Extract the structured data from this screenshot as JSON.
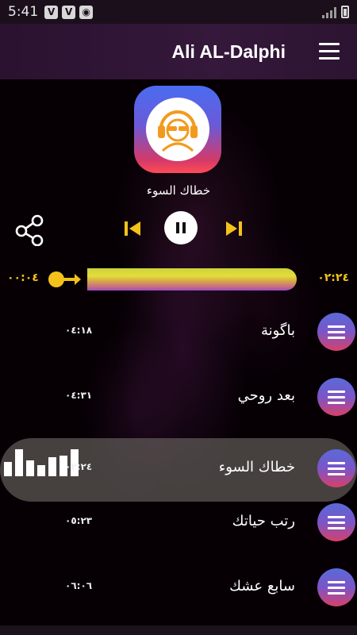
{
  "status_bar": {
    "time": "5:41",
    "icons": [
      {
        "name": "v-icon",
        "glyph": "V"
      },
      {
        "name": "v-icon-2",
        "glyph": "V"
      },
      {
        "name": "target-icon",
        "glyph": "◉"
      }
    ]
  },
  "app_bar": {
    "title": "Ali AL-Dalphi",
    "menu_icon": "hamburger-menu-icon"
  },
  "player": {
    "now_playing": "خطاك السوء",
    "elapsed": "٠٠:٠٤",
    "total": "٠٢:٢٤",
    "progress_fraction": 0.03
  },
  "tracks": [
    {
      "title": "باگونة",
      "duration": "٠٤:١٨",
      "active": false
    },
    {
      "title": "بعد روحي",
      "duration": "٠٤:٣١",
      "active": false
    },
    {
      "title": "خطاك السوء",
      "duration": "٠٢:٢٤",
      "active": true
    },
    {
      "title": "رتب حياتك",
      "duration": "٠٥:٢٣",
      "active": false
    },
    {
      "title": "سابع عشك",
      "duration": "٠٦:٠٦",
      "active": false
    }
  ],
  "colors": {
    "accent": "#f4c21a",
    "app_bar": "#35183b",
    "background": "#060004"
  }
}
